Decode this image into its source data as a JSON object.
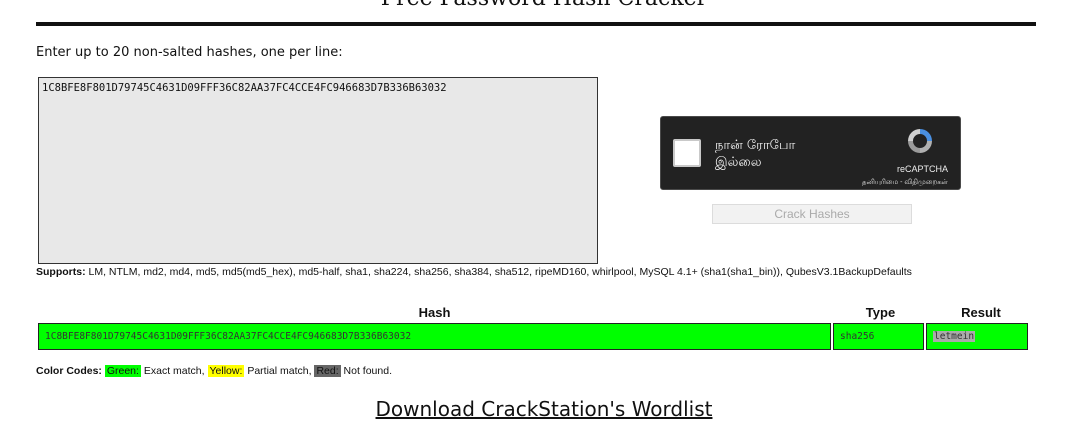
{
  "page": {
    "title": "Free Password Hash Cracker",
    "instructions": "Enter up to 20 non-salted hashes, one per line:"
  },
  "input": {
    "hashes": "1C8BFE8F801D79745C4631D09FFF36C82AA37FC4CCE4FC946683D7B336B63032"
  },
  "captcha": {
    "label": "நான் ரோபோ இல்லை",
    "brand": "reCAPTCHA",
    "links": "தனியுரிமை - விதிமுறைகள்",
    "checked": false,
    "icon": "recaptcha-logo-icon"
  },
  "crack_button": {
    "label": "Crack Hashes",
    "enabled": false
  },
  "supports": {
    "label": "Supports:",
    "text": "LM, NTLM, md2, md4, md5, md5(md5_hex), md5-half, sha1, sha224, sha256, sha384, sha512, ripeMD160, whirlpool, MySQL 4.1+ (sha1(sha1_bin)), QubesV3.1BackupDefaults"
  },
  "results": {
    "headers": {
      "hash": "Hash",
      "type": "Type",
      "result": "Result"
    },
    "rows": [
      {
        "hash": "1C8BFE8F801D79745C4631D09FFF36C82AA37FC4CCE4FC946683D7B336B63032",
        "type": "sha256",
        "result": "letmein",
        "status": "green"
      }
    ]
  },
  "color_codes": {
    "label": "Color Codes:",
    "green": "Green:",
    "green_desc": "Exact match,",
    "yellow": "Yellow:",
    "yellow_desc": "Partial match,",
    "red": "Red:",
    "red_desc": "Not found.",
    "colors": {
      "green": "#00ff00",
      "yellow": "#ffff00",
      "red": "#666666"
    }
  },
  "download_link": "Download CrackStation's Wordlist"
}
